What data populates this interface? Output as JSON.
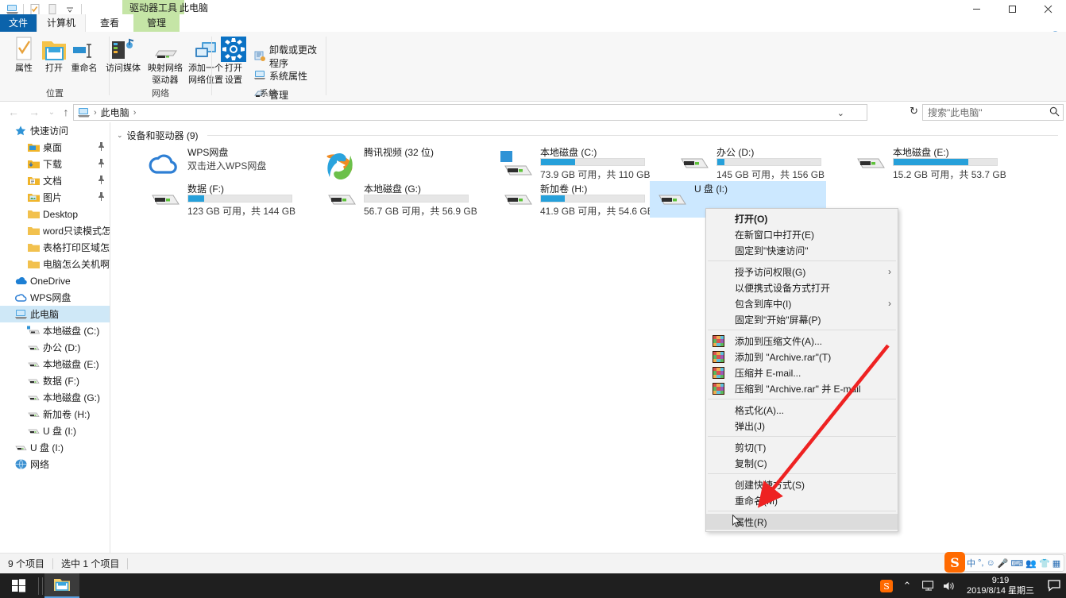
{
  "window": {
    "title": "此电脑",
    "contextual_tab": "驱动器工具",
    "minimize": "—",
    "maximize": "❐",
    "close": "✕",
    "help_icon": "help-icon",
    "collapse_ribbon_icon": "chevron-up-icon"
  },
  "quick_access_toolbar": {
    "items": [
      {
        "name": "this-pc-icon",
        "glyph": "🖥"
      },
      {
        "name": "properties-icon",
        "glyph": "✓"
      },
      {
        "name": "new-folder-icon",
        "glyph": "▯"
      },
      {
        "name": "customize-icon",
        "glyph": "▾"
      }
    ]
  },
  "ribbon_tabs": [
    {
      "label": "文件",
      "name": "tab-file",
      "selected": false,
      "kind": "file"
    },
    {
      "label": "计算机",
      "name": "tab-computer",
      "selected": true,
      "kind": "normal"
    },
    {
      "label": "查看",
      "name": "tab-view",
      "selected": false,
      "kind": "normal"
    },
    {
      "label": "管理",
      "name": "tab-manage",
      "selected": false,
      "kind": "contextual"
    }
  ],
  "ribbon": {
    "groups": [
      {
        "label": "位置",
        "name": "ribbon-group-location",
        "big_buttons": [
          {
            "label": "属性",
            "name": "properties-button",
            "icon": "properties-icon"
          },
          {
            "label": "打开",
            "name": "open-button",
            "icon": "open-folder-icon"
          },
          {
            "label": "重命名",
            "name": "rename-button",
            "icon": "rename-icon"
          }
        ]
      },
      {
        "label": "网络",
        "name": "ribbon-group-network",
        "big_buttons": [
          {
            "label": "访问媒体",
            "name": "access-media-button",
            "icon": "media-server-icon"
          },
          {
            "label": "映射网络\n驱动器",
            "line1": "映射网络",
            "line2": "驱动器",
            "name": "map-network-drive-button",
            "icon": "network-drive-icon"
          },
          {
            "label": "添加一个\n网络位置",
            "line1": "添加一个",
            "line2": "网络位置",
            "name": "add-network-location-button",
            "icon": "add-network-location-icon"
          }
        ]
      },
      {
        "label": "系统",
        "name": "ribbon-group-system",
        "big_buttons": [
          {
            "line1": "打开",
            "line2": "设置",
            "name": "open-settings-button",
            "icon": "gear-icon"
          }
        ],
        "small_buttons": [
          {
            "label": "卸载或更改程序",
            "name": "uninstall-change-program-button",
            "icon": "uninstall-icon"
          },
          {
            "label": "系统属性",
            "name": "system-properties-button",
            "icon": "system-properties-icon"
          },
          {
            "label": "管理",
            "name": "manage-button",
            "icon": "manage-icon"
          }
        ]
      }
    ]
  },
  "addressbar": {
    "back_icon": "back-arrow-icon",
    "forward_icon": "forward-arrow-icon",
    "recent_icon": "chevron-down-icon",
    "up_icon": "up-arrow-icon",
    "breadcrumb_icon": "this-pc-icon",
    "breadcrumb": [
      "此电脑"
    ],
    "separator": "›",
    "dropdown_icon": "chevron-down-icon",
    "refresh_icon": "refresh-icon",
    "search_placeholder": "搜索\"此电脑\"",
    "search_icon": "search-icon"
  },
  "navpane": {
    "items": [
      {
        "label": "快速访问",
        "icon": "star-pin-icon",
        "level": 0,
        "pinned": false
      },
      {
        "label": "桌面",
        "icon": "desktop-folder-icon",
        "level": 1,
        "pinned": true
      },
      {
        "label": "下载",
        "icon": "downloads-folder-icon",
        "level": 1,
        "pinned": true
      },
      {
        "label": "文档",
        "icon": "documents-folder-icon",
        "level": 1,
        "pinned": true
      },
      {
        "label": "图片",
        "icon": "pictures-folder-icon",
        "level": 1,
        "pinned": true
      },
      {
        "label": "Desktop",
        "icon": "folder-icon",
        "level": 1,
        "pinned": false
      },
      {
        "label": "word只读模式怎么改",
        "icon": "folder-icon",
        "level": 1,
        "pinned": false
      },
      {
        "label": "表格打印区域怎么设",
        "icon": "folder-icon",
        "level": 1,
        "pinned": false
      },
      {
        "label": "电脑怎么关机啊 已",
        "icon": "folder-icon",
        "level": 1,
        "pinned": false
      },
      {
        "label": "OneDrive",
        "icon": "onedrive-icon",
        "level": 0,
        "pinned": false
      },
      {
        "label": "WPS网盘",
        "icon": "wps-cloud-icon",
        "level": 0,
        "pinned": false
      },
      {
        "label": "此电脑",
        "icon": "this-pc-icon",
        "level": 0,
        "pinned": false,
        "active": true
      },
      {
        "label": "本地磁盘 (C:)",
        "icon": "windows-drive-icon",
        "level": 1,
        "pinned": false
      },
      {
        "label": "办公 (D:)",
        "icon": "drive-icon",
        "level": 1,
        "pinned": false
      },
      {
        "label": "本地磁盘 (E:)",
        "icon": "drive-icon",
        "level": 1,
        "pinned": false
      },
      {
        "label": "数据 (F:)",
        "icon": "drive-icon",
        "level": 1,
        "pinned": false
      },
      {
        "label": "本地磁盘 (G:)",
        "icon": "drive-icon",
        "level": 1,
        "pinned": false
      },
      {
        "label": "新加卷 (H:)",
        "icon": "drive-icon",
        "level": 1,
        "pinned": false
      },
      {
        "label": "U 盘 (I:)",
        "icon": "drive-icon",
        "level": 1,
        "pinned": false
      },
      {
        "label": "U 盘 (I:)",
        "icon": "drive-icon",
        "level": 0,
        "pinned": false
      },
      {
        "label": "网络",
        "icon": "network-icon",
        "level": 0,
        "pinned": false
      }
    ]
  },
  "content": {
    "group_header": "设备和驱动器 (9)",
    "tiles": [
      {
        "name": "WPS网盘",
        "sub": "双击进入WPS网盘",
        "icon": "wps-cloud-icon",
        "type": "cloud",
        "selected": false
      },
      {
        "name": "腾讯视频 (32 位)",
        "sub": "",
        "icon": "tencent-video-icon",
        "type": "app",
        "selected": false
      },
      {
        "name": "本地磁盘 (C:)",
        "info": "73.9 GB 可用，共 110 GB",
        "icon": "windows-drive-icon",
        "type": "drive",
        "used_pct": 33,
        "bar_color": "#26a0da",
        "selected": false
      },
      {
        "name": "办公 (D:)",
        "info": "145 GB 可用，共 156 GB",
        "icon": "drive-icon",
        "type": "drive",
        "used_pct": 7,
        "bar_color": "#26a0da",
        "selected": false
      },
      {
        "name": "本地磁盘 (E:)",
        "info": "15.2 GB 可用，共 53.7 GB",
        "icon": "drive-icon",
        "type": "drive",
        "used_pct": 72,
        "bar_color": "#26a0da",
        "selected": false
      },
      {
        "name": "数据 (F:)",
        "info": "123 GB 可用，共 144 GB",
        "icon": "drive-icon",
        "type": "drive",
        "used_pct": 15,
        "bar_color": "#26a0da",
        "selected": false
      },
      {
        "name": "本地磁盘 (G:)",
        "info": "56.7 GB 可用，共 56.9 GB",
        "icon": "drive-icon",
        "type": "drive",
        "used_pct": 0,
        "bar_color": "#26a0da",
        "selected": false
      },
      {
        "name": "新加卷 (H:)",
        "info": "41.9 GB 可用，共 54.6 GB",
        "icon": "drive-icon",
        "type": "drive",
        "used_pct": 23,
        "bar_color": "#26a0da",
        "selected": false
      },
      {
        "name": "U 盘 (I:)",
        "info": "",
        "icon": "drive-icon",
        "type": "drive",
        "used_pct": 0,
        "bar_color": "#26a0da",
        "selected": true
      }
    ]
  },
  "context_menu": {
    "items": [
      {
        "label": "打开(O)",
        "name": "menu-open",
        "bold": true,
        "icon": null,
        "arrow": false
      },
      {
        "label": "在新窗口中打开(E)",
        "name": "menu-open-new-window",
        "icon": null,
        "arrow": false
      },
      {
        "label": "固定到\"快速访问\"",
        "name": "menu-pin-quick-access",
        "icon": null,
        "arrow": false
      },
      {
        "separator": true
      },
      {
        "label": "授予访问权限(G)",
        "name": "menu-give-access-to",
        "icon": null,
        "arrow": true
      },
      {
        "label": "以便携式设备方式打开",
        "name": "menu-open-as-portable-device",
        "icon": null,
        "arrow": false
      },
      {
        "label": "包含到库中(I)",
        "name": "menu-include-in-library",
        "icon": null,
        "arrow": true
      },
      {
        "label": "固定到\"开始\"屏幕(P)",
        "name": "menu-pin-to-start",
        "icon": null,
        "arrow": false
      },
      {
        "separator": true
      },
      {
        "label": "添加到压缩文件(A)...",
        "name": "menu-winrar-add-archive",
        "icon": "winrar-icon",
        "arrow": false
      },
      {
        "label": "添加到 \"Archive.rar\"(T)",
        "name": "menu-winrar-add-to-archive-rar",
        "icon": "winrar-icon",
        "arrow": false
      },
      {
        "label": "压缩并 E-mail...",
        "name": "menu-winrar-compress-email",
        "icon": "winrar-icon",
        "arrow": false
      },
      {
        "label": "压缩到 \"Archive.rar\" 并 E-mail",
        "name": "menu-winrar-compress-rar-email",
        "icon": "winrar-icon",
        "arrow": false
      },
      {
        "separator": true
      },
      {
        "label": "格式化(A)...",
        "name": "menu-format",
        "icon": null,
        "arrow": false
      },
      {
        "label": "弹出(J)",
        "name": "menu-eject",
        "icon": null,
        "arrow": false
      },
      {
        "separator": true
      },
      {
        "label": "剪切(T)",
        "name": "menu-cut",
        "icon": null,
        "arrow": false
      },
      {
        "label": "复制(C)",
        "name": "menu-copy",
        "icon": null,
        "arrow": false
      },
      {
        "separator": true
      },
      {
        "label": "创建快捷方式(S)",
        "name": "menu-create-shortcut",
        "icon": null,
        "arrow": false
      },
      {
        "label": "重命名(M)",
        "name": "menu-rename",
        "icon": null,
        "arrow": false
      },
      {
        "separator": true
      },
      {
        "label": "属性(R)",
        "name": "menu-properties",
        "icon": null,
        "arrow": false,
        "highlighted": true
      }
    ]
  },
  "statusbar": {
    "item_count": "9 个项目",
    "selection": "选中 1 个项目",
    "view_details_icon": "details-view-icon",
    "view_tiles_icon": "tiles-view-icon"
  },
  "sogou_bar": {
    "logo": "S",
    "items": [
      "中",
      "°,",
      "☺",
      "🎤",
      "⌨",
      "👥",
      "👕",
      "▦"
    ]
  },
  "taskbar": {
    "start_icon": "windows-start-icon",
    "apps": [
      {
        "name": "file-explorer-taskbar-button",
        "icon": "folder-icon"
      }
    ],
    "tray": {
      "sogou_icon": "sogou-input-icon",
      "show_hidden_icon": "chevron-up-icon",
      "network_icon": "network-monitor-icon",
      "volume_icon": "volume-icon",
      "time": "9:19",
      "date": "2019/8/14 星期三",
      "action_center_icon": "action-center-icon"
    }
  },
  "colors": {
    "accent_blue": "#0b63ab",
    "selection_blue": "#cce8ff",
    "drive_bar_blue": "#26a0da",
    "contextual_tab_green": "#c5e5a6",
    "annotation_red": "#ee2222",
    "taskbar_dark": "#1f1f1f"
  }
}
